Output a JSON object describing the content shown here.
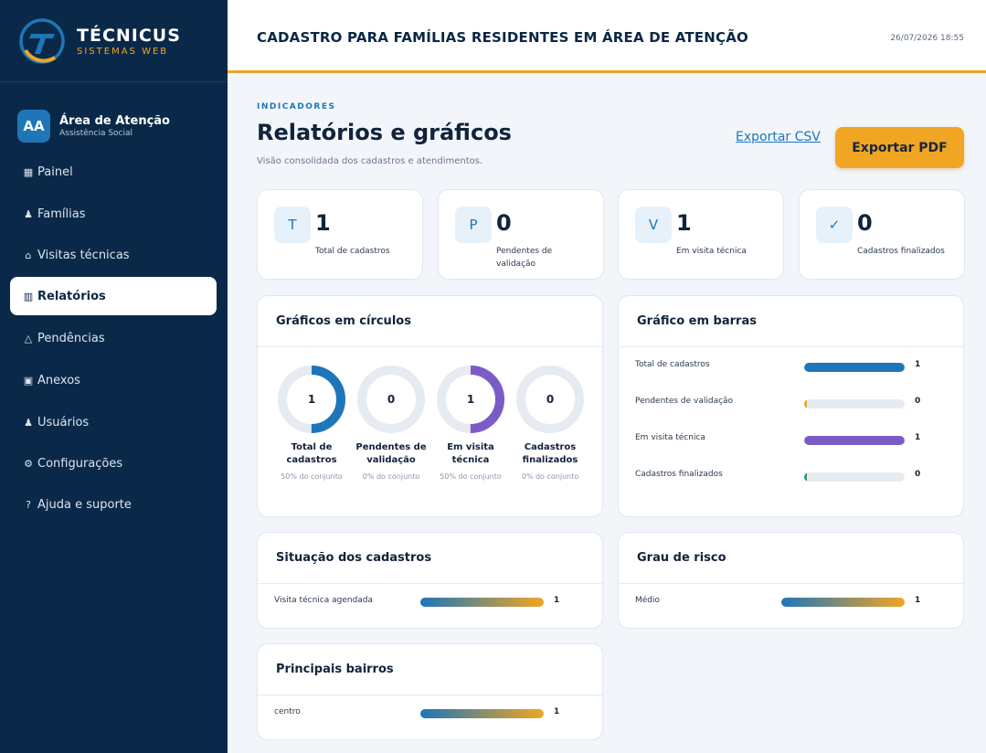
{
  "brand": {
    "name": "TÉCNICUS",
    "subtitle": "SISTEMAS WEB"
  },
  "account": {
    "initials": "AA",
    "name": "Área de Atenção",
    "role": "Assistência Social"
  },
  "nav": [
    {
      "icon": "▦",
      "label": "Painel",
      "active": false
    },
    {
      "icon": "♟",
      "label": "Famílias",
      "active": false
    },
    {
      "icon": "⌂",
      "label": "Visitas técnicas",
      "active": false
    },
    {
      "icon": "▥",
      "label": "Relatórios",
      "active": true
    },
    {
      "icon": "△",
      "label": "Pendências",
      "active": false
    },
    {
      "icon": "▣",
      "label": "Anexos",
      "active": false
    },
    {
      "icon": "♟",
      "label": "Usuários",
      "active": false
    },
    {
      "icon": "⚙",
      "label": "Configurações",
      "active": false
    },
    {
      "icon": "?",
      "label": "Ajuda e suporte",
      "active": false
    }
  ],
  "header": {
    "title": "CADASTRO PARA FAMÍLIAS RESIDENTES EM ÁREA DE ATENÇÃO",
    "datetime": "26/07/2026 18:55"
  },
  "page": {
    "kicker": "INDICADORES",
    "title": "Relatórios e gráficos",
    "subtitle": "Visão consolidada dos cadastros e atendimentos.",
    "export_csv": "Exportar CSV",
    "export_pdf": "Exportar PDF"
  },
  "stats": [
    {
      "icon": "T",
      "value": "1",
      "label": "Total de cadastros"
    },
    {
      "icon": "P",
      "value": "0",
      "label": "Pendentes de validação"
    },
    {
      "icon": "V",
      "value": "1",
      "label": "Em visita técnica"
    },
    {
      "icon": "✓",
      "value": "0",
      "label": "Cadastros finalizados"
    }
  ],
  "circles": {
    "title": "Gráficos em círculos",
    "items": [
      {
        "value": "1",
        "label": "Total de cadastros",
        "pct_text": "50% do conjunto",
        "fraction": 0.5,
        "color": "#1e76b8"
      },
      {
        "value": "0",
        "label": "Pendentes de validação",
        "pct_text": "0% do conjunto",
        "fraction": 0,
        "color": "#f0a623"
      },
      {
        "value": "1",
        "label": "Em visita técnica",
        "pct_text": "50% do conjunto",
        "fraction": 0.5,
        "color": "#7b5cc7"
      },
      {
        "value": "0",
        "label": "Cadastros finalizados",
        "pct_text": "0% do conjunto",
        "fraction": 0,
        "color": "#2e9e6b"
      }
    ]
  },
  "bars": {
    "title": "Gráfico em barras",
    "items": [
      {
        "label": "Total de cadastros",
        "value": "1",
        "fraction": 1,
        "color": "#1e76b8"
      },
      {
        "label": "Pendentes de validação",
        "value": "0",
        "fraction": 0,
        "color": "#f0a623"
      },
      {
        "label": "Em visita técnica",
        "value": "1",
        "fraction": 1,
        "color": "#7b5cc7"
      },
      {
        "label": "Cadastros finalizados",
        "value": "0",
        "fraction": 0,
        "color": "#2e9e6b"
      }
    ]
  },
  "situacao": {
    "title": "Situação dos cadastros",
    "rows": [
      {
        "label": "Visita técnica agendada",
        "value": "1"
      }
    ]
  },
  "risco": {
    "title": "Grau de risco",
    "rows": [
      {
        "label": "Médio",
        "value": "1"
      }
    ]
  },
  "bairros": {
    "title": "Principais bairros",
    "rows": [
      {
        "label": "centro",
        "value": "1"
      }
    ]
  },
  "colors": {
    "sidebar": "#0a2948",
    "accent": "#f0a623",
    "primary": "#1e76b8",
    "purple": "#7b5cc7",
    "green": "#2e9e6b"
  }
}
